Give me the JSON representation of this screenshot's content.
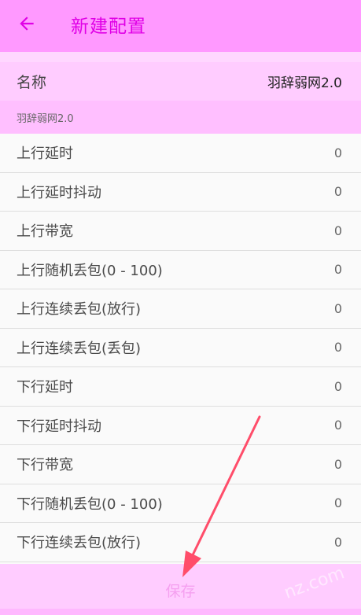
{
  "header": {
    "title": "新建配置",
    "back_icon": "arrow-left-icon",
    "accent_color": "#e000e6",
    "background_color": "#ff99ff"
  },
  "name_row": {
    "label": "名称",
    "value": "羽辞弱网2.0"
  },
  "section": {
    "title": "羽辞弱网2.0"
  },
  "settings": [
    {
      "label": "上行延时",
      "value": "0"
    },
    {
      "label": "上行延时抖动",
      "value": "0"
    },
    {
      "label": "上行带宽",
      "value": "0"
    },
    {
      "label": "上行随机丢包(0 - 100)",
      "value": "0"
    },
    {
      "label": "上行连续丢包(放行)",
      "value": "0"
    },
    {
      "label": "上行连续丢包(丢包)",
      "value": "0"
    },
    {
      "label": "下行延时",
      "value": "0"
    },
    {
      "label": "下行延时抖动",
      "value": "0"
    },
    {
      "label": "下行带宽",
      "value": "0"
    },
    {
      "label": "下行随机丢包(0 - 100)",
      "value": "0"
    },
    {
      "label": "下行连续丢包(放行)",
      "value": "0"
    }
  ],
  "footer": {
    "save_label": "保存"
  },
  "watermark": {
    "text": "nz.com"
  }
}
